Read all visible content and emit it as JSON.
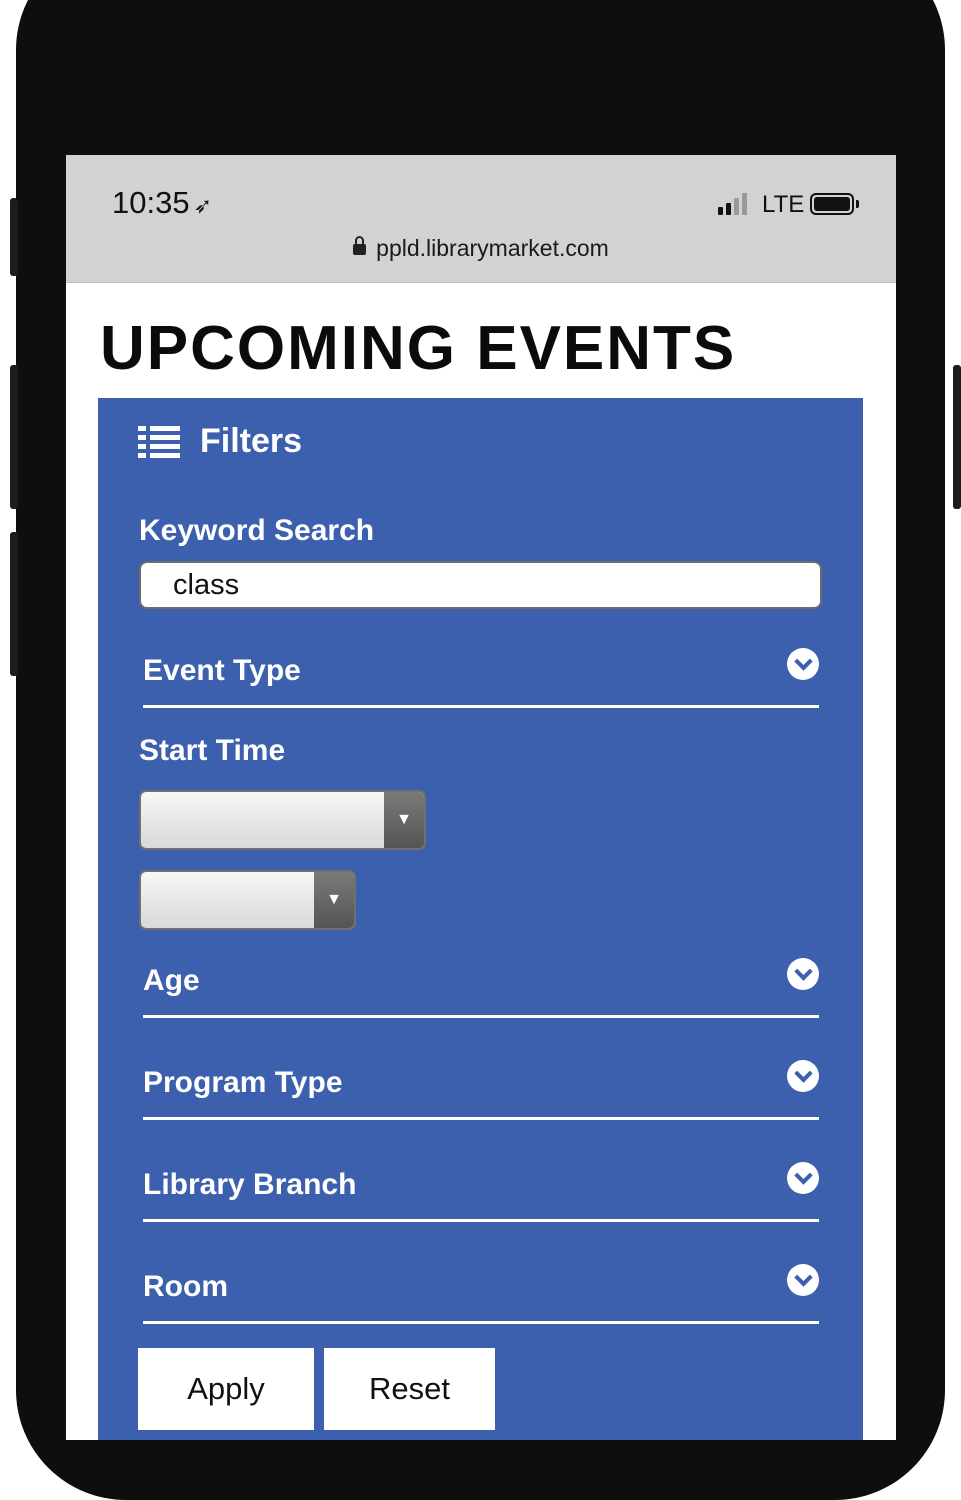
{
  "status_bar": {
    "time": "10:35",
    "location_icon": "location-arrow-icon",
    "network": "LTE",
    "url": "ppld.librarymarket.com"
  },
  "page": {
    "title": "UPCOMING EVENTS"
  },
  "filters": {
    "title": "Filters",
    "icon": "list-icon",
    "keyword_label": "Keyword Search",
    "keyword_value": "class",
    "event_type_label": "Event Type",
    "start_time_label": "Start Time",
    "age_label": "Age",
    "program_type_label": "Program Type",
    "library_branch_label": "Library Branch",
    "room_label": "Room",
    "apply_label": "Apply",
    "reset_label": "Reset",
    "accent_color": "#3c5fae"
  }
}
